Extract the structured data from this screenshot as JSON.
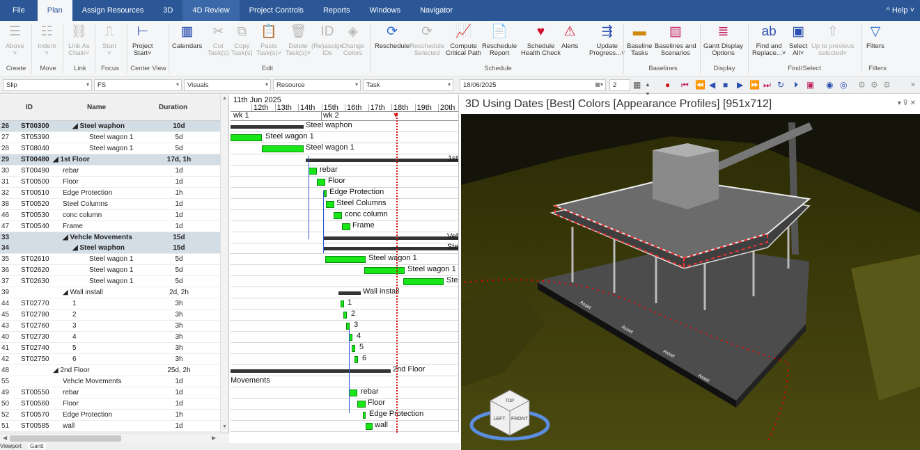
{
  "menu": {
    "tabs": [
      "File",
      "Plan",
      "Assign Resources",
      "3D",
      "4D Review",
      "Project Controls",
      "Reports",
      "Windows",
      "Navigator"
    ],
    "active": "Plan",
    "highlight": "4D Review",
    "help": "^ Help ˅"
  },
  "ribbon": {
    "buttons": [
      {
        "label": "Above",
        "sub": "˅",
        "icon": "indent-above-icon",
        "disabled": true
      },
      {
        "label": "Indent",
        "sub": "˅",
        "icon": "indent-icon",
        "disabled": true
      },
      {
        "label": "Link As",
        "sub": "Chain˅",
        "icon": "link-icon",
        "disabled": true
      },
      {
        "label": "Start",
        "sub": "˅",
        "icon": "focus-start-icon",
        "disabled": true
      },
      {
        "label": "Project",
        "sub": "Start˅",
        "icon": "center-view-icon",
        "disabled": false
      },
      {
        "label": "Calendars",
        "sub": "",
        "icon": "calendar-icon",
        "disabled": false
      },
      {
        "label": "Cut",
        "sub": "Task(s)",
        "icon": "cut-icon",
        "disabled": true
      },
      {
        "label": "Copy",
        "sub": "Task(s)",
        "icon": "copy-icon",
        "disabled": true
      },
      {
        "label": "Paste",
        "sub": "Task(s)˅",
        "icon": "paste-icon",
        "disabled": true
      },
      {
        "label": "Delete",
        "sub": "Task(s)˅",
        "icon": "delete-icon",
        "disabled": true
      },
      {
        "label": "(Re)assign",
        "sub": "IDs",
        "icon": "assign-ids-icon",
        "disabled": true
      },
      {
        "label": "Change",
        "sub": "Colors",
        "icon": "change-colors-icon",
        "disabled": true
      },
      {
        "label": "Reschedule",
        "sub": "",
        "icon": "reschedule-icon",
        "disabled": false
      },
      {
        "label": "Reschedule",
        "sub": "Selected",
        "icon": "reschedule-selected-icon",
        "disabled": true
      },
      {
        "label": "Compute",
        "sub": "Critical Path",
        "icon": "critical-path-icon",
        "disabled": false
      },
      {
        "label": "Reschedule",
        "sub": "Report",
        "icon": "report-icon",
        "disabled": false
      },
      {
        "label": "Schedule",
        "sub": "Health Check",
        "icon": "health-check-icon",
        "disabled": false
      },
      {
        "label": "Alerts",
        "sub": "",
        "icon": "alert-icon",
        "disabled": false
      },
      {
        "label": "Update",
        "sub": "Progress...˅",
        "icon": "update-progress-icon",
        "disabled": false
      },
      {
        "label": "Baseline",
        "sub": "Tasks",
        "icon": "baseline-tasks-icon",
        "disabled": false
      },
      {
        "label": "Baselines and",
        "sub": "Scenarios",
        "icon": "baselines-scenarios-icon",
        "disabled": false
      },
      {
        "label": "Gantt Display",
        "sub": "Options",
        "icon": "gantt-display-icon",
        "disabled": false
      },
      {
        "label": "Find and",
        "sub": "Replace...˅",
        "icon": "find-replace-icon",
        "disabled": false
      },
      {
        "label": "Select",
        "sub": "All˅",
        "icon": "select-all-icon",
        "disabled": false
      },
      {
        "label": "Up to previous",
        "sub": "selected˅",
        "icon": "up-previous-icon",
        "disabled": true
      },
      {
        "label": "Filters",
        "sub": "",
        "icon": "filter-icon",
        "disabled": false
      }
    ],
    "groups": [
      "Create",
      "Move",
      "Link",
      "Focus",
      "Center View",
      "Edit",
      "Schedule",
      "Baselines",
      "Display",
      "Find/Select",
      "Filters"
    ]
  },
  "toolbar": {
    "slip": "Slip",
    "fs": "FS",
    "visuals": "Visuals",
    "resource": "Resource",
    "task": "Task",
    "date": "18/06/2025",
    "number": "2"
  },
  "grid": {
    "headers": {
      "id": "ID",
      "name": "Name",
      "duration": "Duration"
    },
    "rows": [
      {
        "rn": "26",
        "id": "ST00300",
        "name": "◢ Steel waphon",
        "dur": "10d",
        "lvl": 2,
        "sum": true
      },
      {
        "rn": "27",
        "id": "ST05390",
        "name": "Steel wagon 1",
        "dur": "5d",
        "lvl": 3,
        "sum": false
      },
      {
        "rn": "28",
        "id": "ST08040",
        "name": "Steel wagon 1",
        "dur": "5d",
        "lvl": 3,
        "sum": false
      },
      {
        "rn": "29",
        "id": "ST00480",
        "name": "◢ 1st Floor",
        "dur": "17d, 1h",
        "lvl": 0,
        "sum": true
      },
      {
        "rn": "30",
        "id": "ST00490",
        "name": "rebar",
        "dur": "1d",
        "lvl": 1,
        "sum": false
      },
      {
        "rn": "31",
        "id": "ST00500",
        "name": "Floor",
        "dur": "1d",
        "lvl": 1,
        "sum": false
      },
      {
        "rn": "32",
        "id": "ST00510",
        "name": "Edge Protection",
        "dur": "1h",
        "lvl": 1,
        "sum": false
      },
      {
        "rn": "38",
        "id": "ST00520",
        "name": "Steel Columns",
        "dur": "1d",
        "lvl": 1,
        "sum": false
      },
      {
        "rn": "46",
        "id": "ST00530",
        "name": "conc column",
        "dur": "1d",
        "lvl": 1,
        "sum": false
      },
      {
        "rn": "47",
        "id": "ST00540",
        "name": "Frame",
        "dur": "1d",
        "lvl": 1,
        "sum": false
      },
      {
        "rn": "33",
        "id": "",
        "name": "◢ Vehcle Movements",
        "dur": "15d",
        "lvl": 1,
        "sum": true
      },
      {
        "rn": "34",
        "id": "",
        "name": "◢ Steel waphon",
        "dur": "15d",
        "lvl": 2,
        "sum": true
      },
      {
        "rn": "35",
        "id": "ST02610",
        "name": "Steel wagon 1",
        "dur": "5d",
        "lvl": 3,
        "sum": false
      },
      {
        "rn": "36",
        "id": "ST02620",
        "name": "Steel wagon 1",
        "dur": "5d",
        "lvl": 3,
        "sum": false
      },
      {
        "rn": "37",
        "id": "ST02630",
        "name": "Steel wagon 1",
        "dur": "5d",
        "lvl": 3,
        "sum": false
      },
      {
        "rn": "39",
        "id": "",
        "name": "◢ Wall install",
        "dur": "2d, 2h",
        "lvl": 1,
        "sum": false
      },
      {
        "rn": "44",
        "id": "ST02770",
        "name": "1",
        "dur": "3h",
        "lvl": 2,
        "sum": false
      },
      {
        "rn": "45",
        "id": "ST02780",
        "name": "2",
        "dur": "3h",
        "lvl": 2,
        "sum": false
      },
      {
        "rn": "43",
        "id": "ST02760",
        "name": "3",
        "dur": "3h",
        "lvl": 2,
        "sum": false
      },
      {
        "rn": "40",
        "id": "ST02730",
        "name": "4",
        "dur": "3h",
        "lvl": 2,
        "sum": false
      },
      {
        "rn": "41",
        "id": "ST02740",
        "name": "5",
        "dur": "3h",
        "lvl": 2,
        "sum": false
      },
      {
        "rn": "42",
        "id": "ST02750",
        "name": "6",
        "dur": "3h",
        "lvl": 2,
        "sum": false
      },
      {
        "rn": "48",
        "id": "",
        "name": "◢ 2nd Floor",
        "dur": "25d, 2h",
        "lvl": 0,
        "sum": false
      },
      {
        "rn": "55",
        "id": "",
        "name": "Vehcle Movements",
        "dur": "1d",
        "lvl": 1,
        "sum": false
      },
      {
        "rn": "49",
        "id": "ST00550",
        "name": "rebar",
        "dur": "1d",
        "lvl": 1,
        "sum": false
      },
      {
        "rn": "50",
        "id": "ST00560",
        "name": "Floor",
        "dur": "1d",
        "lvl": 1,
        "sum": false
      },
      {
        "rn": "52",
        "id": "ST00570",
        "name": "Edge Protection",
        "dur": "1h",
        "lvl": 1,
        "sum": false
      },
      {
        "rn": "51",
        "id": "ST00585",
        "name": "wall",
        "dur": "1d",
        "lvl": 1,
        "sum": false
      }
    ]
  },
  "gantt": {
    "month": "11th Jun 2025",
    "days": [
      "12th",
      "13th",
      "14th",
      "15th",
      "16th",
      "17th",
      "18th",
      "19th",
      "20th"
    ],
    "weeks": [
      "wk 1",
      "wk 2"
    ],
    "labels": [
      "Steel waphon",
      "Steel wagon 1",
      "Steel wagon 1",
      "1st",
      "rebar",
      "Floor",
      "Edge Protection",
      "Steel Columns",
      "conc column",
      "Frame",
      "Vehc",
      "Ste",
      "Steel wagon 1",
      "Steel wagon 1",
      "Ste",
      "Wall install",
      "1",
      "2",
      "3",
      "4",
      "5",
      "6",
      "2nd Floor",
      "Movements",
      "rebar",
      "Floor",
      "Edge Protection",
      "wall"
    ]
  },
  "viewport": {
    "title": "3D Using Dates [Best] Colors [Appearance Profiles]  [951x712]",
    "controls": "▾ ⊽ ✕",
    "cube": {
      "top": "TOP",
      "left": "LEFT",
      "front": "FRONT"
    },
    "asset_label": "Asset"
  },
  "bottom_tabs": [
    "Viewport",
    "Gantt"
  ]
}
